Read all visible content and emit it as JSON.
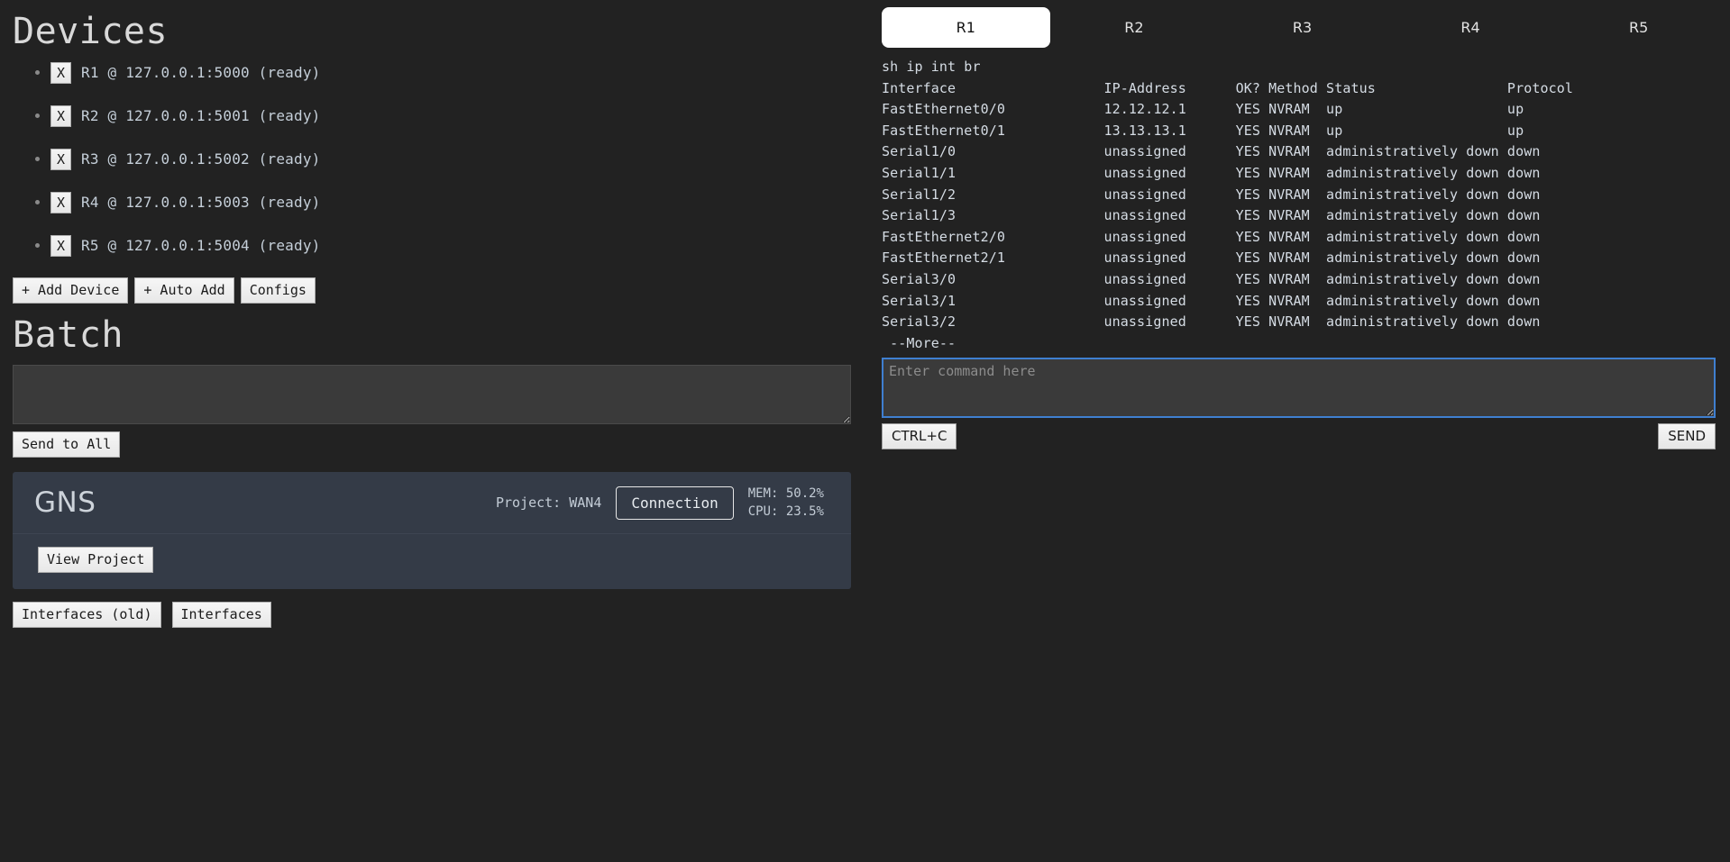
{
  "devices_section": {
    "title": "Devices",
    "remove_label": "X",
    "items": [
      {
        "label": "R1 @ 127.0.0.1:5000 (ready)"
      },
      {
        "label": "R2 @ 127.0.0.1:5001 (ready)"
      },
      {
        "label": "R3 @ 127.0.0.1:5002 (ready)"
      },
      {
        "label": "R4 @ 127.0.0.1:5003 (ready)"
      },
      {
        "label": "R5 @ 127.0.0.1:5004 (ready)"
      }
    ],
    "add_device_label": "+ Add Device",
    "auto_add_label": "+ Auto Add",
    "configs_label": "Configs"
  },
  "batch_section": {
    "title": "Batch",
    "textarea_value": "",
    "textarea_placeholder": "",
    "send_to_all_label": "Send to All"
  },
  "gns_panel": {
    "logo": "GNS",
    "project_label": "Project: WAN4",
    "connection_label": "Connection",
    "mem_label": "MEM: 50.2%",
    "cpu_label": "CPU: 23.5%",
    "view_project_label": "View Project"
  },
  "bottom_buttons": {
    "interfaces_old_label": "Interfaces (old)",
    "interfaces_label": "Interfaces"
  },
  "console": {
    "tabs": [
      {
        "label": "R1",
        "active": true
      },
      {
        "label": "R2",
        "active": false
      },
      {
        "label": "R3",
        "active": false
      },
      {
        "label": "R4",
        "active": false
      },
      {
        "label": "R5",
        "active": false
      }
    ],
    "output": "sh ip int br\nInterface                  IP-Address      OK? Method Status                Protocol\nFastEthernet0/0            12.12.12.1      YES NVRAM  up                    up\nFastEthernet0/1            13.13.13.1      YES NVRAM  up                    up\nSerial1/0                  unassigned      YES NVRAM  administratively down down\nSerial1/1                  unassigned      YES NVRAM  administratively down down\nSerial1/2                  unassigned      YES NVRAM  administratively down down\nSerial1/3                  unassigned      YES NVRAM  administratively down down\nFastEthernet2/0            unassigned      YES NVRAM  administratively down down\nFastEthernet2/1            unassigned      YES NVRAM  administratively down down\nSerial3/0                  unassigned      YES NVRAM  administratively down down\nSerial3/1                  unassigned      YES NVRAM  administratively down down\nSerial3/2                  unassigned      YES NVRAM  administratively down down\n --More--",
    "command_value": "",
    "command_placeholder": "Enter command here",
    "ctrl_c_label": "CTRL+C",
    "send_label": "SEND"
  },
  "colors": {
    "page_background": "#222222",
    "panel_background": "#343b47",
    "input_background": "#3a3a3a",
    "focus_border": "#3f7fd0",
    "active_tab_background": "#ffffff",
    "text": "#d5dce4"
  }
}
